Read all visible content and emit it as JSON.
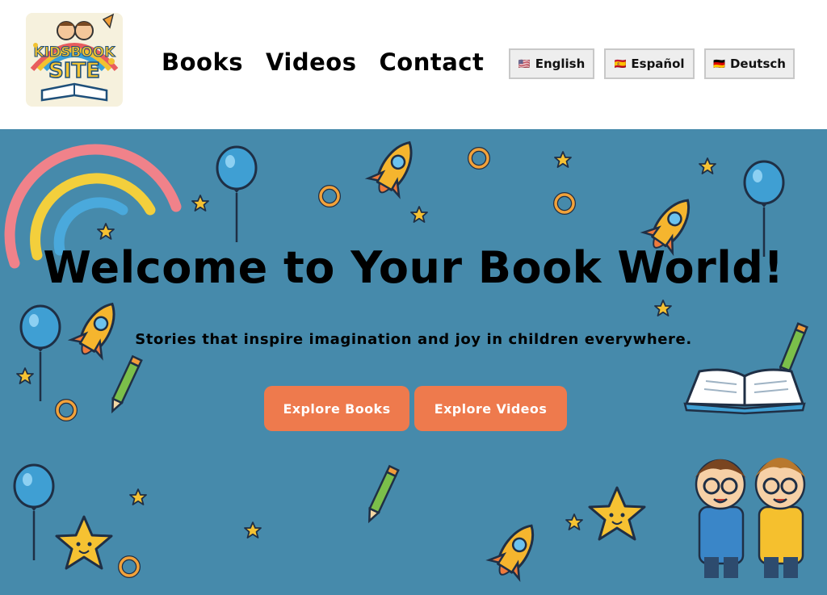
{
  "logo": {
    "line1": "KIDSBOOK",
    "line2": "SITE"
  },
  "nav": {
    "items": [
      "Books",
      "Videos",
      "Contact"
    ]
  },
  "languages": [
    {
      "flag": "🇺🇸",
      "label": "English"
    },
    {
      "flag": "🇪🇸",
      "label": "Español"
    },
    {
      "flag": "🇩🇪",
      "label": "Deutsch"
    }
  ],
  "hero": {
    "title": "Welcome to Your Book World!",
    "subtitle": "Stories that inspire imagination and joy in children everywhere.",
    "buttons": [
      "Explore Books",
      "Explore Videos"
    ]
  },
  "colors": {
    "hero_bg": "#468aab",
    "button_bg": "#ee7a4d"
  }
}
